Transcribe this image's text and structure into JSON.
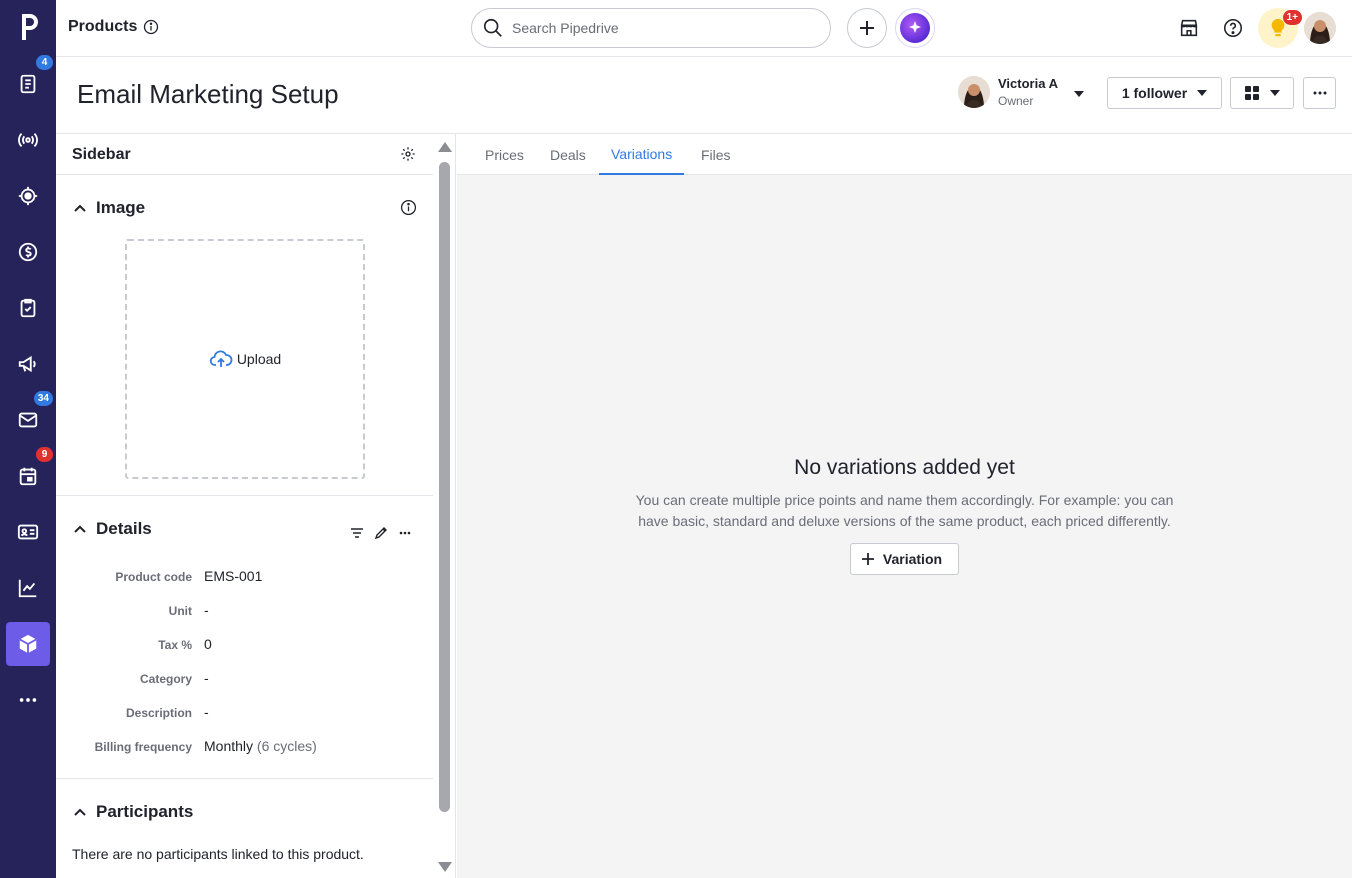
{
  "app": {
    "rail": {
      "items": [
        {
          "icon": "leads-icon",
          "badge": "4",
          "badge_color": "#317ae2"
        },
        {
          "icon": "broadcast-icon"
        },
        {
          "icon": "target-icon"
        },
        {
          "icon": "deals-dollar-icon"
        },
        {
          "icon": "activities-clipboard-icon"
        },
        {
          "icon": "campaigns-megaphone-icon"
        },
        {
          "icon": "mail-icon",
          "badge": "34",
          "badge_color": "#317ae2"
        },
        {
          "icon": "calendar-icon",
          "badge": "9",
          "badge_color": "#e0312f"
        },
        {
          "icon": "contacts-card-icon"
        },
        {
          "icon": "insights-chart-icon"
        },
        {
          "icon": "products-box-icon",
          "active": true
        },
        {
          "icon": "more-icon"
        }
      ]
    }
  },
  "topbar": {
    "breadcrumb": "Products",
    "search_placeholder": "Search Pipedrive",
    "notification_badge": "1+"
  },
  "header": {
    "title": "Email Marketing Setup",
    "owner_name": "Victoria A",
    "owner_role": "Owner",
    "follower_label": "1 follower"
  },
  "sidebar": {
    "title": "Sidebar",
    "image_section": "Image",
    "upload_label": "Upload",
    "details_section": "Details",
    "details": [
      {
        "label": "Product code",
        "value": "EMS-001"
      },
      {
        "label": "Unit",
        "value": "-"
      },
      {
        "label": "Tax %",
        "value": "0"
      },
      {
        "label": "Category",
        "value": "-"
      },
      {
        "label": "Description",
        "value": "-"
      },
      {
        "label": "Billing frequency",
        "value": "Monthly",
        "extra": "(6 cycles)"
      }
    ],
    "participants_section": "Participants",
    "participants_empty": "There are no participants linked to this product."
  },
  "main": {
    "tabs": [
      "Prices",
      "Deals",
      "Variations",
      "Files"
    ],
    "active_tab": "Variations",
    "empty_title": "No variations added yet",
    "empty_text": "You can create multiple price points and name them accordingly. For example: you can have basic, standard and deluxe versions of the same product, each priced differently.",
    "add_button": "Variation"
  },
  "colors": {
    "rail_bg": "#26235a",
    "rail_active": "#6c5ce7",
    "accent": "#317ae2",
    "badge_red": "#e0312f"
  }
}
